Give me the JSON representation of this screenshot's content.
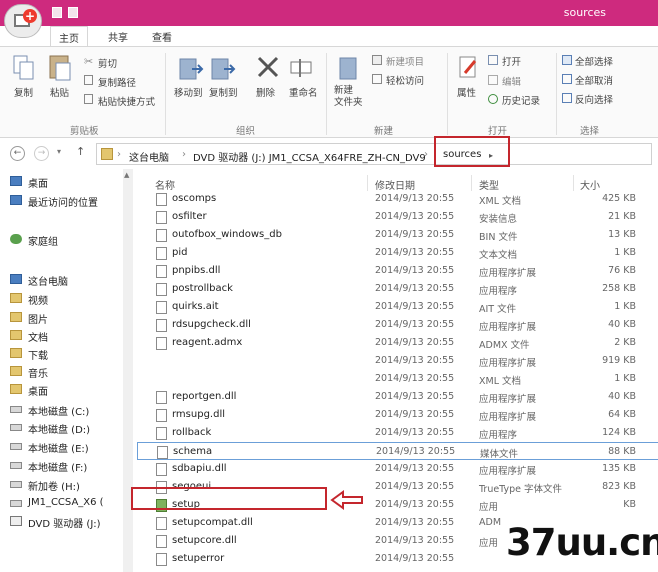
{
  "window": {
    "title": "sources"
  },
  "ribbon_tabs": [
    {
      "label": "主页",
      "active": true
    },
    {
      "label": "共享",
      "active": false
    },
    {
      "label": "查看",
      "active": false
    }
  ],
  "ribbon": {
    "clipboard": {
      "group": "剪贴板",
      "copy": "复制",
      "paste": "粘贴",
      "cut": "剪切",
      "copy_path": "复制路径",
      "paste_shortcut": "粘贴快捷方式"
    },
    "organize": {
      "group": "组织",
      "move_to": "移动到",
      "copy_to": "复制到",
      "delete": "删除",
      "rename": "重命名"
    },
    "new": {
      "group": "新建",
      "new_folder": "新建\n文件夹",
      "new_item": "新建项目",
      "easy_access": "轻松访问"
    },
    "open": {
      "group": "打开",
      "properties": "属性",
      "open": "打开",
      "edit": "编辑",
      "history": "历史记录"
    },
    "select": {
      "group": "选择",
      "select_all": "全部选择",
      "select_none": "全部取消",
      "invert": "反向选择"
    }
  },
  "address": {
    "crumbs": [
      "这台电脑",
      "DVD 驱动器 (J:) JM1_CCSA_X64FRE_ZH-CN_DV9",
      "sources"
    ]
  },
  "nav_pane": {
    "items": [
      {
        "label": "桌面",
        "icon": "desktop-icon"
      },
      {
        "label": "最近访问的位置",
        "icon": "recent-icon"
      },
      {
        "label": "家庭组",
        "icon": "homegroup-icon"
      },
      {
        "label": "这台电脑",
        "icon": "computer-icon"
      },
      {
        "label": "视频",
        "icon": "folder-icon"
      },
      {
        "label": "图片",
        "icon": "folder-icon"
      },
      {
        "label": "文档",
        "icon": "folder-icon"
      },
      {
        "label": "下载",
        "icon": "folder-icon"
      },
      {
        "label": "音乐",
        "icon": "folder-icon"
      },
      {
        "label": "桌面",
        "icon": "folder-icon"
      },
      {
        "label": "本地磁盘 (C:)",
        "icon": "drive-icon"
      },
      {
        "label": "本地磁盘 (D:)",
        "icon": "drive-icon"
      },
      {
        "label": "本地磁盘 (E:)",
        "icon": "drive-icon"
      },
      {
        "label": "本地磁盘 (F:)",
        "icon": "drive-icon"
      },
      {
        "label": "新加卷 (H:)",
        "icon": "drive-icon"
      },
      {
        "label": "JM1_CCSA_X6 (",
        "icon": "drive-icon"
      },
      {
        "label": "DVD 驱动器 (J:)",
        "icon": "dvd-icon"
      }
    ]
  },
  "columns": {
    "name": "名称",
    "date": "修改日期",
    "type": "类型",
    "size": "大小"
  },
  "files": [
    {
      "name": "oscomps",
      "date": "2014/9/13 20:55",
      "type": "XML 文档",
      "size": "425 KB"
    },
    {
      "name": "osfilter",
      "date": "2014/9/13 20:55",
      "type": "安装信息",
      "size": "21 KB"
    },
    {
      "name": "outofbox_windows_db",
      "date": "2014/9/13 20:55",
      "type": "BIN 文件",
      "size": "13 KB"
    },
    {
      "name": "pid",
      "date": "2014/9/13 20:55",
      "type": "文本文档",
      "size": "1 KB"
    },
    {
      "name": "pnpibs.dll",
      "date": "2014/9/13 20:55",
      "type": "应用程序扩展",
      "size": "76 KB"
    },
    {
      "name": "postrollback",
      "date": "2014/9/13 20:55",
      "type": "应用程序",
      "size": "258 KB"
    },
    {
      "name": "quirks.ait",
      "date": "2014/9/13 20:55",
      "type": "AIT 文件",
      "size": "1 KB"
    },
    {
      "name": "rdsupgcheck.dll",
      "date": "2014/9/13 20:55",
      "type": "应用程序扩展",
      "size": "40 KB"
    },
    {
      "name": "reagent.admx",
      "date": "2014/9/13 20:55",
      "type": "ADMX 文件",
      "size": "2 KB"
    },
    {
      "name": "",
      "date": "2014/9/13 20:55",
      "type": "应用程序扩展",
      "size": "919 KB"
    },
    {
      "name": "",
      "date": "2014/9/13 20:55",
      "type": "XML 文档",
      "size": "1 KB"
    },
    {
      "name": "reportgen.dll",
      "date": "2014/9/13 20:55",
      "type": "应用程序扩展",
      "size": "40 KB"
    },
    {
      "name": "rmsupg.dll",
      "date": "2014/9/13 20:55",
      "type": "应用程序扩展",
      "size": "64 KB"
    },
    {
      "name": "rollback",
      "date": "2014/9/13 20:55",
      "type": "应用程序",
      "size": "124 KB"
    },
    {
      "name": "schema",
      "date": "2014/9/13 20:55",
      "type": "媒体文件",
      "size": "88 KB",
      "selected": true
    },
    {
      "name": "sdbapiu.dll",
      "date": "2014/9/13 20:55",
      "type": "应用程序扩展",
      "size": "135 KB"
    },
    {
      "name": "segoeui",
      "date": "2014/9/13 20:55",
      "type": "TrueType 字体文件",
      "size": "823 KB"
    },
    {
      "name": "setup",
      "date": "2014/9/13 20:55",
      "type": "应用",
      "size": "KB",
      "highlight": true
    },
    {
      "name": "setupcompat.dll",
      "date": "2014/9/13 20:55",
      "type": "ADM",
      "size": ""
    },
    {
      "name": "setupcore.dll",
      "date": "2014/9/13 20:55",
      "type": "应用",
      "size": ""
    },
    {
      "name": "setuperror",
      "date": "2014/9/13 20:55",
      "type": "",
      "size": ""
    }
  ],
  "watermark": "37uu.cn",
  "colors": {
    "titlebar": "#ce2a7e",
    "highlight_red": "#c4262d",
    "selection_border": "#6b9fd8"
  }
}
